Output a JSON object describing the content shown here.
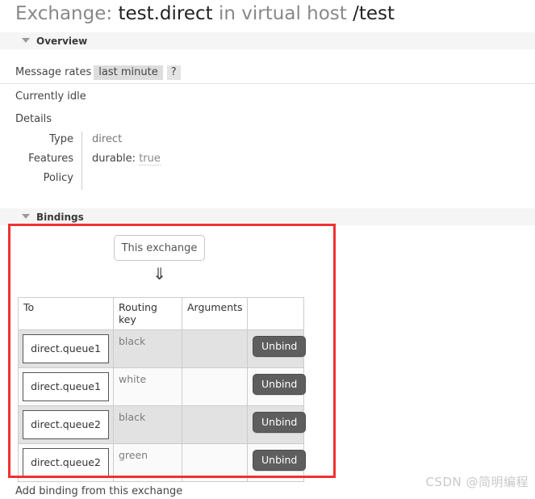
{
  "title": {
    "prefix": "Exchange:",
    "exchange_name": "test.direct",
    "middle": "in virtual host",
    "vhost": "/test"
  },
  "sections": {
    "overview": {
      "label": "Overview",
      "caret_icon": "caret-down-icon"
    },
    "bindings": {
      "label": "Bindings",
      "caret_icon": "caret-down-icon"
    }
  },
  "overview": {
    "message_rates_label": "Message rates",
    "period_chip": "last minute",
    "help_chip": "?",
    "idle_text": "Currently idle",
    "details_label": "Details",
    "details_rows": [
      {
        "key": "Type",
        "value": "direct"
      },
      {
        "key": "Features",
        "feature_key": "durable:",
        "feature_value": "true"
      },
      {
        "key": "Policy",
        "value": ""
      }
    ]
  },
  "bindings": {
    "source_button": "This exchange",
    "arrow_glyph": "⇓",
    "columns": [
      "To",
      "Routing key",
      "Arguments",
      ""
    ],
    "rows": [
      {
        "to": "direct.queue1",
        "routing_key": "black",
        "arguments": "",
        "action": "Unbind"
      },
      {
        "to": "direct.queue1",
        "routing_key": "white",
        "arguments": "",
        "action": "Unbind"
      },
      {
        "to": "direct.queue2",
        "routing_key": "black",
        "arguments": "",
        "action": "Unbind"
      },
      {
        "to": "direct.queue2",
        "routing_key": "green",
        "arguments": "",
        "action": "Unbind"
      }
    ],
    "add_binding_label": "Add binding from this exchange"
  },
  "annotation": {
    "highlight_color": "#f03131"
  },
  "watermark": "CSDN @简明编程"
}
